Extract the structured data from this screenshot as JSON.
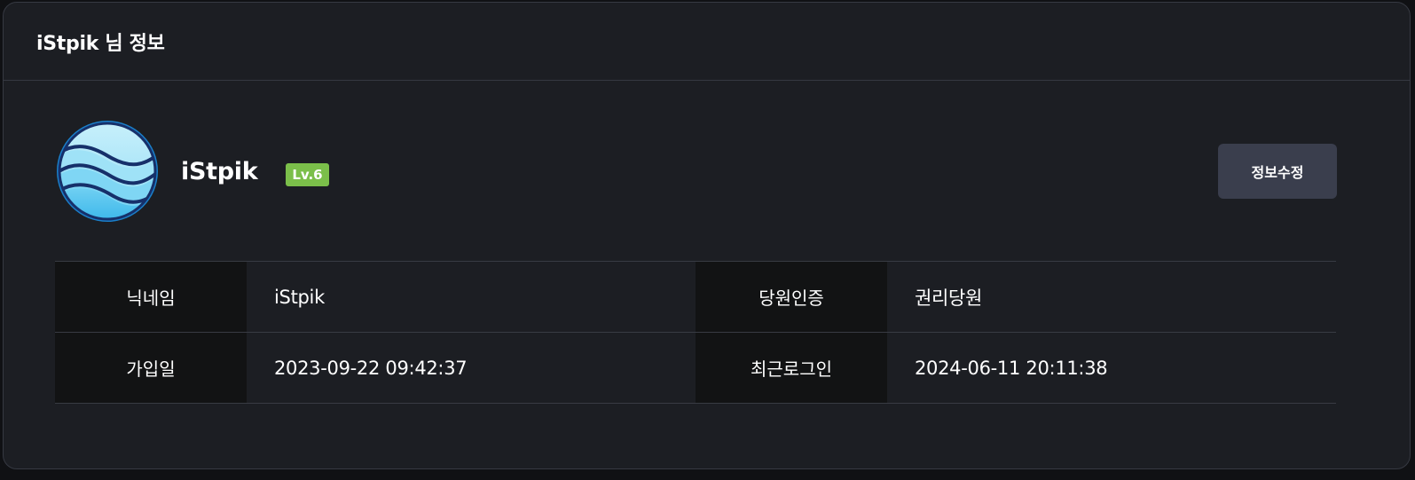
{
  "header": {
    "title": "iStpik 님 정보"
  },
  "profile": {
    "name": "iStpik",
    "level": "Lv.6",
    "avatar_icon": "wave-avatar-icon",
    "edit_button_label": "정보수정"
  },
  "info": {
    "rows": [
      {
        "left_label": "닉네임",
        "left_value": "iStpik",
        "right_label": "당원인증",
        "right_value": "권리당원"
      },
      {
        "left_label": "가입일",
        "left_value": "2023-09-22 09:42:37",
        "right_label": "최근로그인",
        "right_value": "2024-06-11 20:11:38"
      }
    ]
  },
  "colors": {
    "background": "#1c1e23",
    "level_badge": "#7bbf4a",
    "edit_button": "#3a3e4d",
    "label_cell": "#121314",
    "avatar_outline": "#1a7fc9"
  }
}
